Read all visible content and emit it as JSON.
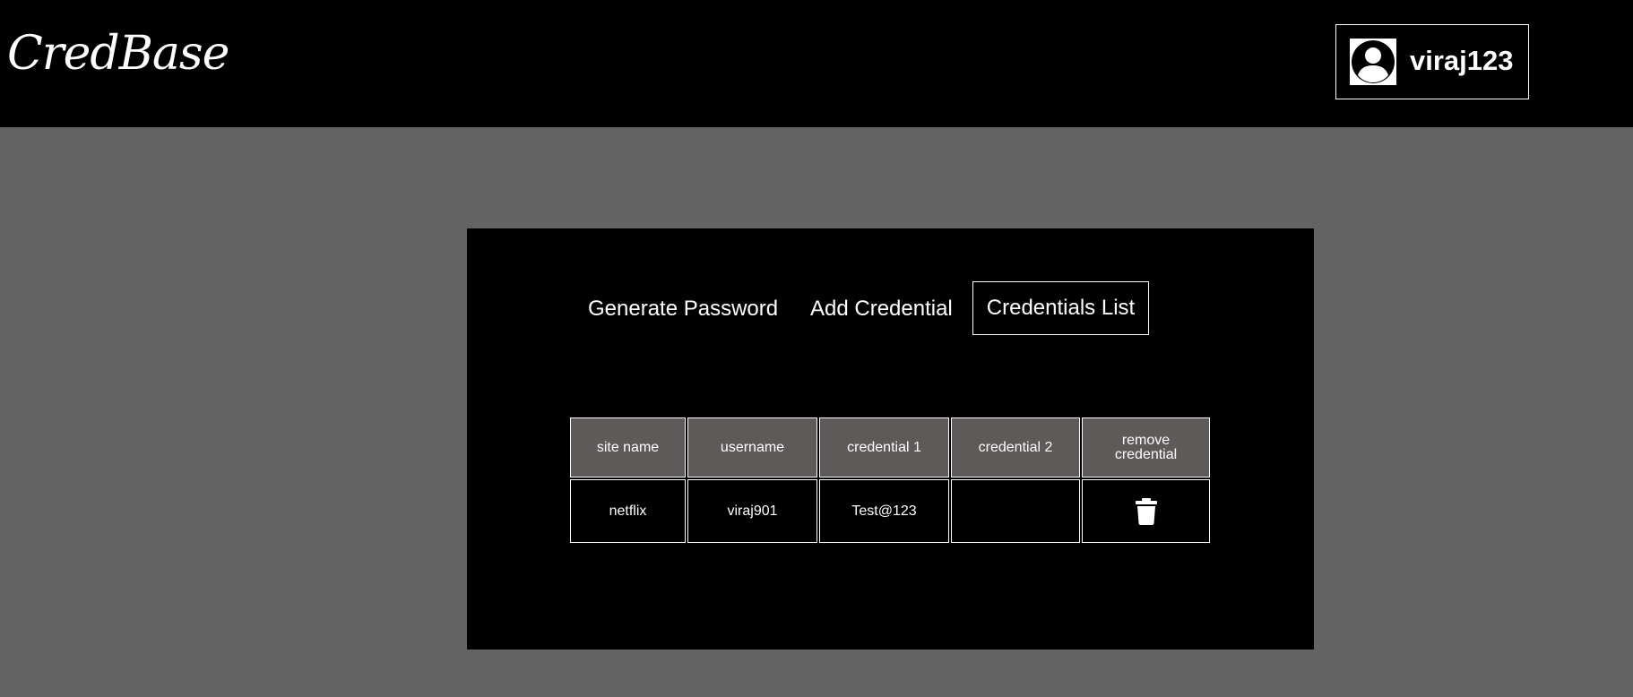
{
  "header": {
    "logo": "CredBase",
    "user": {
      "icon": "account-circle-icon",
      "name": "viraj123"
    }
  },
  "tabs": [
    {
      "label": "Generate Password",
      "active": false
    },
    {
      "label": "Add Credential",
      "active": false
    },
    {
      "label": "Credentials List",
      "active": true
    }
  ],
  "table": {
    "columns": [
      "site name",
      "username",
      "credential 1",
      "credential 2",
      "remove credential"
    ],
    "rows": [
      {
        "site_name": "netflix",
        "username": "viraj901",
        "credential_1": "Test@123",
        "credential_2": "",
        "remove_icon": "trash-icon"
      }
    ]
  },
  "colors": {
    "background": "#636363",
    "header": "#000000",
    "panel": "#000000",
    "table_header": "#5e5a59",
    "text": "#ffffff"
  }
}
